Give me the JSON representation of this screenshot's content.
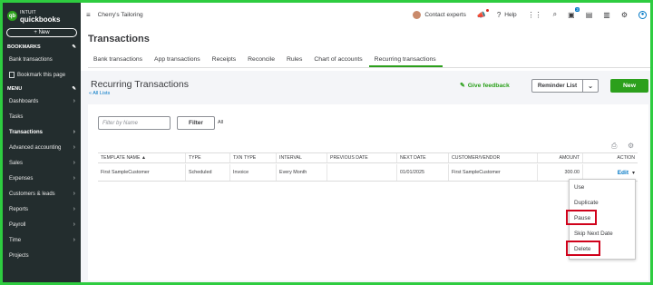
{
  "brand": {
    "line1": "INTUIT",
    "line2": "quickbooks",
    "mark": "qb"
  },
  "sidebar": {
    "new_label": "+ New",
    "bookmarks_title": "BOOKMARKS",
    "bookmarks": [
      {
        "label": "Bank transactions"
      },
      {
        "label": "Bookmark this page"
      }
    ],
    "menu_title": "MENU",
    "items": [
      {
        "label": "Dashboards",
        "chevron": "›"
      },
      {
        "label": "Tasks",
        "chevron": ""
      },
      {
        "label": "Transactions",
        "chevron": "›"
      },
      {
        "label": "Advanced accounting",
        "chevron": "›"
      },
      {
        "label": "Sales",
        "chevron": "›"
      },
      {
        "label": "Expenses",
        "chevron": "›"
      },
      {
        "label": "Customers & leads",
        "chevron": "›"
      },
      {
        "label": "Reports",
        "chevron": "›"
      },
      {
        "label": "Payroll",
        "chevron": "›"
      },
      {
        "label": "Time",
        "chevron": "›"
      },
      {
        "label": "Projects",
        "chevron": ""
      }
    ]
  },
  "topbar": {
    "company": "Cherry's Tailoring",
    "contact": "Contact experts",
    "help": "Help",
    "notif_badge": "3"
  },
  "page": {
    "title": "Transactions",
    "tabs": [
      {
        "label": "Bank transactions"
      },
      {
        "label": "App transactions"
      },
      {
        "label": "Receipts"
      },
      {
        "label": "Reconcile"
      },
      {
        "label": "Rules"
      },
      {
        "label": "Chart of accounts"
      },
      {
        "label": "Recurring transactions"
      }
    ]
  },
  "recurring": {
    "title": "Recurring Transactions",
    "all_lists": "« All Lists",
    "feedback": "Give feedback",
    "reminder": "Reminder List",
    "reminder_caret": "⌄",
    "new": "New",
    "filter_placeholder": "Filter by Name",
    "filter_btn": "Filter",
    "all": "All",
    "headers": [
      "TEMPLATE NAME ▲",
      "TYPE",
      "TXN TYPE",
      "INTERVAL",
      "PREVIOUS DATE",
      "NEXT DATE",
      "CUSTOMER/VENDOR",
      "AMOUNT",
      "ACTION"
    ],
    "row": {
      "name": "First SampleCustomer",
      "type": "Scheduled",
      "txn_type": "Invoice",
      "interval": "Every Month",
      "previous": "",
      "next": "01/01/2025",
      "customer": "First SampleCustomer",
      "amount": "300.00",
      "action": "Edit",
      "caret": "▾"
    },
    "menu": [
      "Use",
      "Duplicate",
      "Pause",
      "Skip Next Date",
      "Delete"
    ]
  },
  "colors": {
    "accent_green": "#2ca01c",
    "link_blue": "#0077c5",
    "highlight_red": "#d0021b",
    "sidebar_bg": "#232d2e",
    "frame_green": "#2ecc40"
  }
}
